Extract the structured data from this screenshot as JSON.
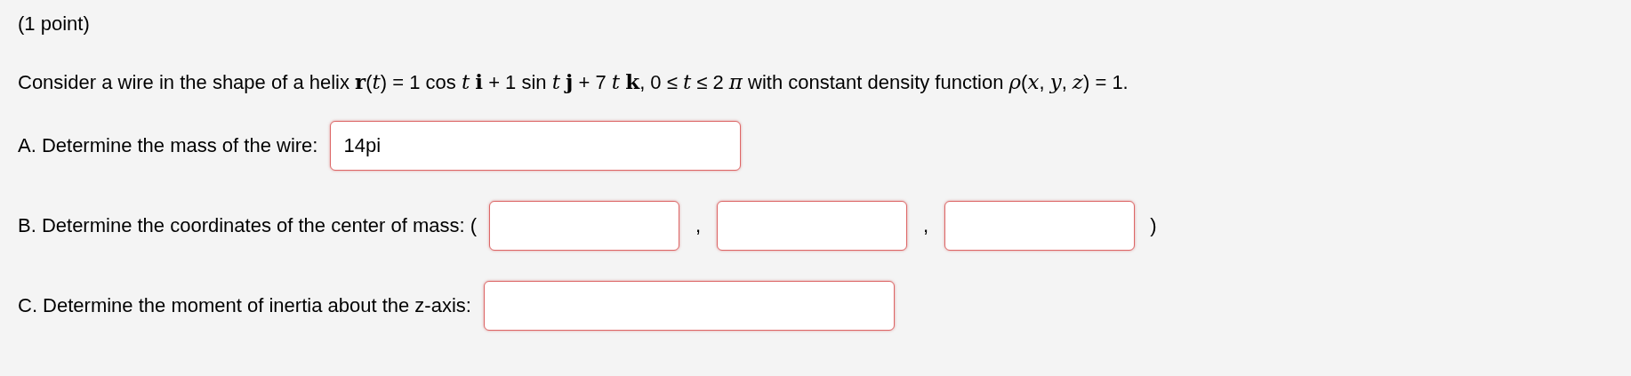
{
  "points": "(1 point)",
  "problem": "Consider a wire in the shape of a helix **r**(*t*) = 1 cos *t* **i** + 1 sin *t* **j** + 7 *t* **k**, 0 ≤ *t* ≤ 2 *π* with constant density function *ρ*(*x*, *y*, *z*) = 1.",
  "parts": [
    {
      "kind": "single",
      "label": "A. Determine the mass of the wire:",
      "answer": "14pi"
    },
    {
      "kind": "tuple",
      "label": "B. Determine the coordinates of the center of mass: (",
      "separators": [
        ",",
        ","
      ],
      "close": ")"
    },
    {
      "kind": "single",
      "label": "C. Determine the moment of inertia about the z-axis:"
    }
  ]
}
